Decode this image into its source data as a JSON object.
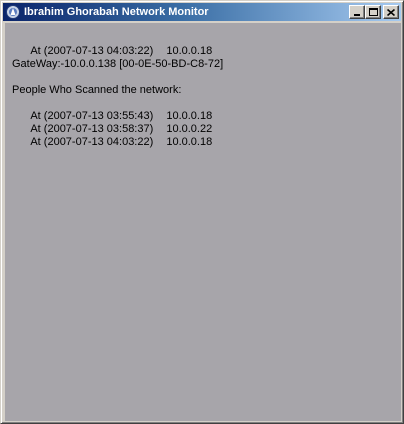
{
  "window": {
    "title": "Ibrahim Ghorabah Network Monitor"
  },
  "current": {
    "time": "At (2007-07-13 04:03:22)",
    "ip": "10.0.0.18"
  },
  "gateway": {
    "text": "GateWay:-10.0.0.138 [00-0E-50-BD-C8-72]"
  },
  "scanners": {
    "heading": "People Who Scanned the network:",
    "rows": [
      {
        "time": "At (2007-07-13 03:55:43)",
        "ip": "10.0.0.18"
      },
      {
        "time": "At (2007-07-13 03:58:37)",
        "ip": "10.0.0.22"
      },
      {
        "time": "At (2007-07-13 04:03:22)",
        "ip": "10.0.0.18"
      }
    ]
  },
  "icons": {
    "app": "app-icon",
    "minimize": "minimize-icon",
    "maximize": "maximize-icon",
    "close": "close-icon"
  },
  "colors": {
    "title_start": "#0a246a",
    "title_end": "#a6caf0",
    "client_background": "#a7a5aa",
    "frame": "#d4d0c8"
  }
}
